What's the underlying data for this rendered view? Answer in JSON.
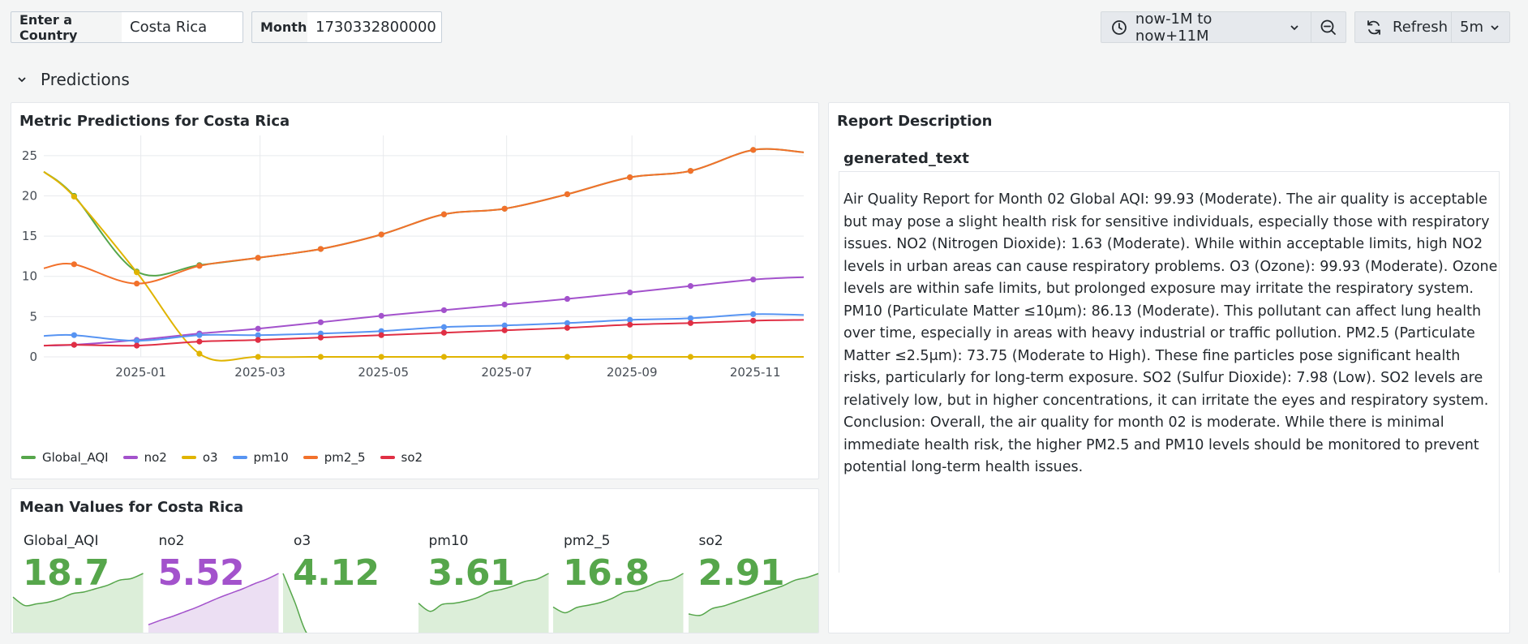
{
  "vars": {
    "country_label": "Enter a Country",
    "country_value": "Costa Rica",
    "month_label": "Month",
    "month_value": "1730332800000"
  },
  "toolbar": {
    "time_range": "now-1M to now+11M",
    "refresh_label": "Refresh",
    "interval": "5m"
  },
  "row": {
    "title": "Predictions"
  },
  "chart_panel": {
    "title": "Metric Predictions for Costa Rica"
  },
  "report_panel": {
    "title": "Report Description",
    "column_header": "generated_text",
    "text": "Air Quality Report for Month 02 Global AQI: 99.93 (Moderate). The air quality is acceptable but may pose a slight health risk for sensitive individuals, especially those with respiratory issues. NO2 (Nitrogen Dioxide): 1.63 (Moderate). While within acceptable limits, high NO2 levels in urban areas can cause respiratory problems. O3 (Ozone): 99.93 (Moderate). Ozone levels are within safe limits, but prolonged exposure may irritate the respiratory system. PM10 (Particulate Matter ≤10μm): 86.13 (Moderate). This pollutant can affect lung health over time, especially in areas with heavy industrial or traffic pollution. PM2.5 (Particulate Matter ≤2.5μm): 73.75 (Moderate to High). These fine particles pose significant health risks, particularly for long-term exposure. SO2 (Sulfur Dioxide): 7.98 (Low). SO2 levels are relatively low, but in higher concentrations, it can irritate the eyes and respiratory system. Conclusion: Overall, the air quality for month 02 is moderate. While there is minimal immediate health risk, the higher PM2.5 and PM10 levels should be monitored to prevent potential long-term health issues."
  },
  "stats_panel": {
    "title": "Mean Values for Costa Rica",
    "stats": [
      {
        "name": "Global_AQI",
        "value": "18.7",
        "color": "#56a64b",
        "fill": "#dceed9",
        "spark": [
          11,
          8.5,
          9,
          9.5,
          10.5,
          12,
          12.5,
          13.5,
          14.5,
          16,
          16.5,
          18
        ]
      },
      {
        "name": "no2",
        "value": "5.52",
        "color": "#a352cc",
        "fill": "#ecdff3",
        "spark": [
          1.5,
          2.2,
          2.8,
          3.5,
          4.2,
          5,
          5.8,
          6.5,
          7.2,
          8,
          8.7,
          9.6
        ]
      },
      {
        "name": "o3",
        "value": "4.12",
        "color": "#56a64b",
        "fill": "#dceed9",
        "spark": [
          20,
          10.5,
          0.4,
          0,
          0,
          0,
          0,
          0,
          0,
          0,
          0,
          0
        ]
      },
      {
        "name": "pm10",
        "value": "3.61",
        "color": "#56a64b",
        "fill": "#dceed9",
        "spark": [
          2.7,
          2,
          2.6,
          2.7,
          2.9,
          3.2,
          3.7,
          3.9,
          4.2,
          4.6,
          4.8,
          5.3
        ]
      },
      {
        "name": "pm2_5",
        "value": "16.8",
        "color": "#56a64b",
        "fill": "#dceed9",
        "spark": [
          11.5,
          9.1,
          11.3,
          12.3,
          13.4,
          15.2,
          17.7,
          18.4,
          20.2,
          22.3,
          23.1,
          25.7
        ]
      },
      {
        "name": "so2",
        "value": "2.91",
        "color": "#56a64b",
        "fill": "#dceed9",
        "spark": [
          1.5,
          1.4,
          1.9,
          2.1,
          2.4,
          2.7,
          3,
          3.3,
          3.6,
          4,
          4.2,
          4.5
        ]
      }
    ]
  },
  "chart_data": {
    "type": "line",
    "x": [
      "2024-11-29",
      "2024-12-30",
      "2025-01-30",
      "2025-02-28",
      "2025-03-31",
      "2025-04-30",
      "2025-05-31",
      "2025-06-30",
      "2025-07-31",
      "2025-08-31",
      "2025-09-30",
      "2025-10-31"
    ],
    "x_ticks": [
      "2025-01",
      "2025-03",
      "2025-05",
      "2025-07",
      "2025-09",
      "2025-11"
    ],
    "y_ticks": [
      0,
      5,
      10,
      15,
      20,
      25
    ],
    "ylim": [
      0,
      27.5
    ],
    "grid": true,
    "legend_position": "bottom",
    "series": [
      {
        "name": "Global_AQI",
        "color": "#56a64b",
        "values": [
          20,
          10.6,
          11.4,
          12.3,
          13.4,
          15.2,
          17.7,
          18.4,
          20.2,
          22.3,
          23.1,
          25.7
        ]
      },
      {
        "name": "no2",
        "color": "#a352cc",
        "values": [
          1.5,
          2.1,
          2.9,
          3.5,
          4.3,
          5.1,
          5.8,
          6.5,
          7.2,
          8,
          8.8,
          9.6
        ]
      },
      {
        "name": "o3",
        "color": "#e0b400",
        "values": [
          19.9,
          10.5,
          0.4,
          0,
          0,
          0,
          0,
          0,
          0,
          0,
          0,
          0
        ]
      },
      {
        "name": "pm10",
        "color": "#5794f2",
        "values": [
          2.7,
          2.0,
          2.7,
          2.7,
          2.9,
          3.2,
          3.7,
          3.9,
          4.2,
          4.6,
          4.8,
          5.3
        ]
      },
      {
        "name": "pm2_5",
        "color": "#f2712b",
        "values": [
          11.5,
          9.1,
          11.3,
          12.3,
          13.4,
          15.2,
          17.7,
          18.4,
          20.2,
          22.3,
          23.1,
          25.7
        ]
      },
      {
        "name": "so2",
        "color": "#e02f44",
        "values": [
          1.5,
          1.4,
          1.9,
          2.1,
          2.4,
          2.7,
          3.0,
          3.3,
          3.6,
          4.0,
          4.2,
          4.5
        ]
      }
    ]
  }
}
